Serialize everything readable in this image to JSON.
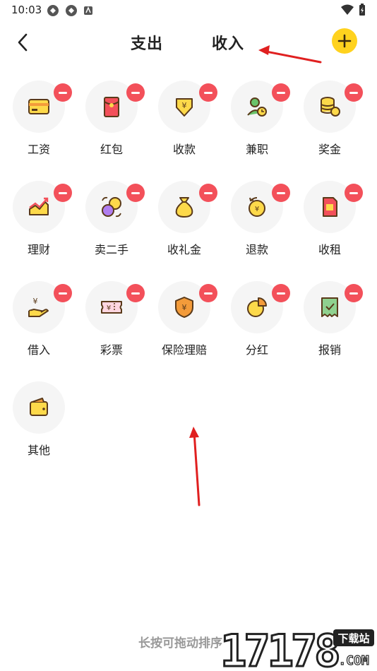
{
  "status_bar": {
    "time": "10:03"
  },
  "header": {
    "tab_expense": "支出",
    "tab_income": "收入"
  },
  "categories": [
    {
      "label": "工资",
      "icon": "card-icon"
    },
    {
      "label": "红包",
      "icon": "red-envelope-icon"
    },
    {
      "label": "收款",
      "icon": "receive-money-icon"
    },
    {
      "label": "兼职",
      "icon": "part-time-icon"
    },
    {
      "label": "奖金",
      "icon": "coins-icon"
    },
    {
      "label": "理财",
      "icon": "investment-chart-icon"
    },
    {
      "label": "卖二手",
      "icon": "exchange-icon"
    },
    {
      "label": "收礼金",
      "icon": "money-bag-icon"
    },
    {
      "label": "退款",
      "icon": "refund-icon"
    },
    {
      "label": "收租",
      "icon": "rent-icon"
    },
    {
      "label": "借入",
      "icon": "borrow-hand-icon"
    },
    {
      "label": "彩票",
      "icon": "lottery-ticket-icon"
    },
    {
      "label": "保险理赔",
      "icon": "insurance-shield-icon"
    },
    {
      "label": "分红",
      "icon": "pie-chart-icon"
    },
    {
      "label": "报销",
      "icon": "receipt-icon"
    },
    {
      "label": "其他",
      "icon": "wallet-icon"
    }
  ],
  "hint": "长按可拖动排序",
  "watermark": {
    "number": "17178",
    "tag": "下载站",
    "domain": ".COM"
  },
  "colors": {
    "accent": "#ffd21e",
    "delete": "#f3505a",
    "icon_fill": "#fdd94a",
    "icon_stroke": "#5a3a1a"
  }
}
